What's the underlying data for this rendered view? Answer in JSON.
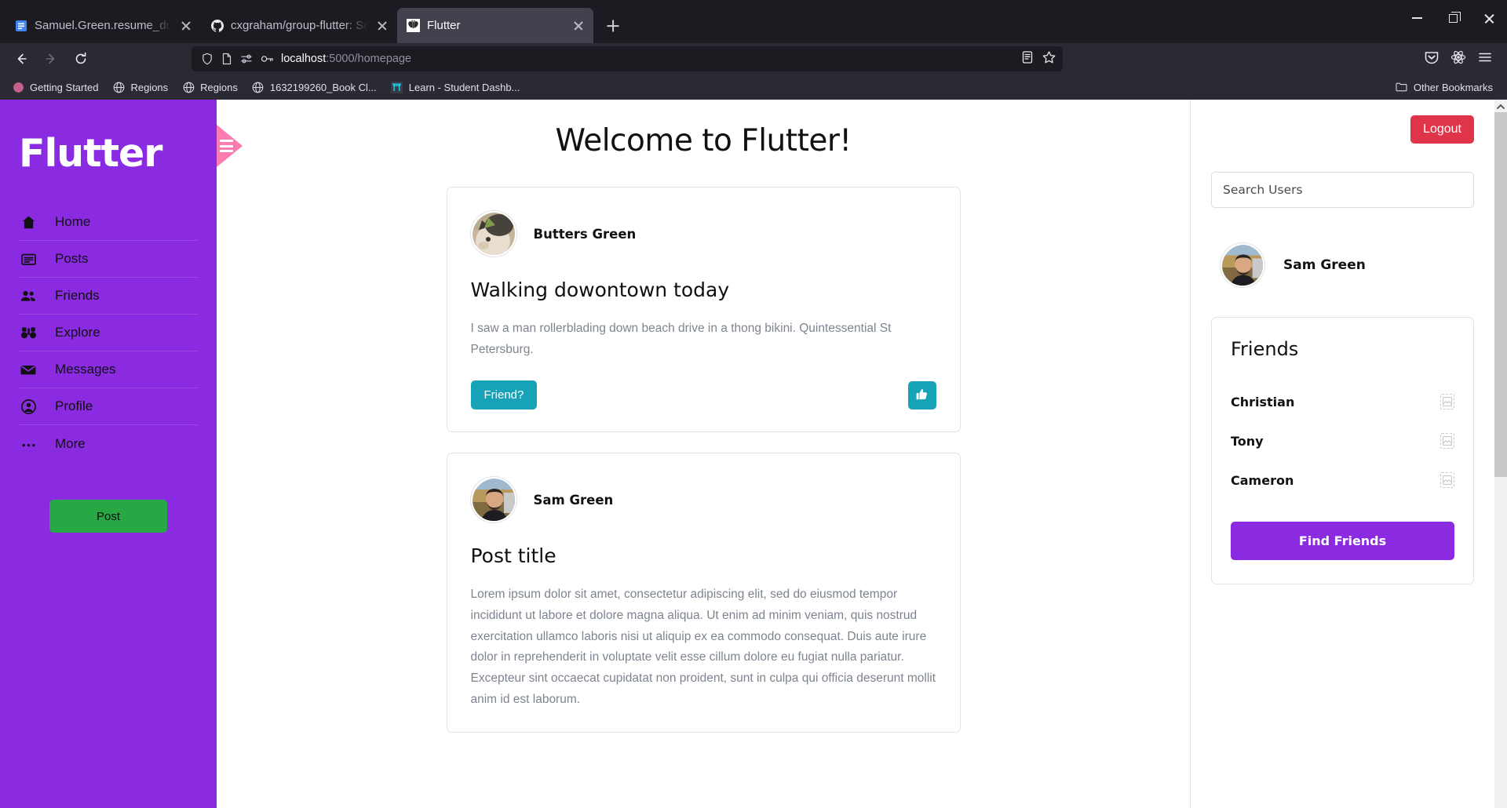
{
  "browser": {
    "tabs": [
      {
        "title": "Samuel.Green.resume_duy edits",
        "favicon": "document-icon",
        "active": false
      },
      {
        "title": "cxgraham/group-flutter: Social",
        "favicon": "github-icon",
        "active": false
      },
      {
        "title": "Flutter",
        "favicon": "butterfly-icon",
        "active": true
      }
    ],
    "new_tab_label": "+",
    "window_controls": {
      "minimize": "minimize-icon",
      "maximize": "maximize-icon",
      "close": "close-icon"
    },
    "url": {
      "host": "localhost",
      "rest": ":5000/homepage"
    },
    "url_icons": [
      "shield-icon",
      "page-icon",
      "permissions-icon",
      "key-icon"
    ],
    "nav_icons": {
      "back": "back-arrow-icon",
      "forward": "forward-arrow-icon",
      "reload": "reload-icon"
    },
    "toolbar_right": [
      "reader-icon",
      "bookmark-star-icon",
      "pocket-icon",
      "extension-icon",
      "menu-icon"
    ],
    "bookmarks": [
      {
        "label": "Getting Started",
        "icon": "firefox-icon"
      },
      {
        "label": "Regions",
        "icon": "globe-icon"
      },
      {
        "label": "Regions",
        "icon": "globe-icon"
      },
      {
        "label": "1632199260_Book Cl...",
        "icon": "globe-icon"
      },
      {
        "label": "Learn - Student Dashb...",
        "icon": "torii-icon"
      }
    ],
    "other_bookmarks": {
      "label": "Other Bookmarks",
      "icon": "folder-icon"
    }
  },
  "sidebar": {
    "brand": "Flutter",
    "items": [
      {
        "label": "Home",
        "icon": "home-icon"
      },
      {
        "label": "Posts",
        "icon": "posts-icon"
      },
      {
        "label": "Friends",
        "icon": "friends-icon"
      },
      {
        "label": "Explore",
        "icon": "binoculars-icon"
      },
      {
        "label": "Messages",
        "icon": "envelope-icon"
      },
      {
        "label": "Profile",
        "icon": "profile-icon"
      },
      {
        "label": "More",
        "icon": "ellipsis-icon"
      }
    ],
    "post_button": "Post",
    "toggle": "hamburger-icon",
    "bg_color": "#8a2be2",
    "post_button_color": "#28a745"
  },
  "main": {
    "page_title": "Welcome to Flutter!",
    "posts": [
      {
        "author": "Butters Green",
        "avatar": "cat-avatar",
        "title": "Walking dowontown today",
        "body": "I saw a man rollerblading down beach drive in a thong bikini. Quintessential St Petersburg.",
        "friend_button": "Friend?",
        "like_icon": "thumbs-up-icon"
      },
      {
        "author": "Sam Green",
        "avatar": "man-avatar",
        "title": "Post title",
        "body": "Lorem ipsum dolor sit amet, consectetur adipiscing elit, sed do eiusmod tempor incididunt ut labore et dolore magna aliqua. Ut enim ad minim veniam, quis nostrud exercitation ullamco laboris nisi ut aliquip ex ea commodo consequat. Duis aute irure dolor in reprehenderit in voluptate velit esse cillum dolore eu fugiat nulla pariatur. Excepteur sint occaecat cupidatat non proident, sunt in culpa qui officia deserunt mollit anim id est laborum."
      }
    ]
  },
  "right_panel": {
    "logout_label": "Logout",
    "logout_color": "#e03449",
    "search_placeholder": "Search Users",
    "current_user": {
      "name": "Sam Green",
      "avatar": "man-avatar"
    },
    "friends_card": {
      "title": "Friends",
      "friends": [
        {
          "name": "Christian",
          "thumb": "broken-image-icon"
        },
        {
          "name": "Tony",
          "thumb": "broken-image-icon"
        },
        {
          "name": "Cameron",
          "thumb": "broken-image-icon"
        }
      ],
      "find_friends_label": "Find Friends",
      "find_friends_color": "#8a2be2"
    }
  },
  "scrollbar": {
    "up_arrow": "chevron-up-icon",
    "thumb": "scroll-thumb"
  }
}
